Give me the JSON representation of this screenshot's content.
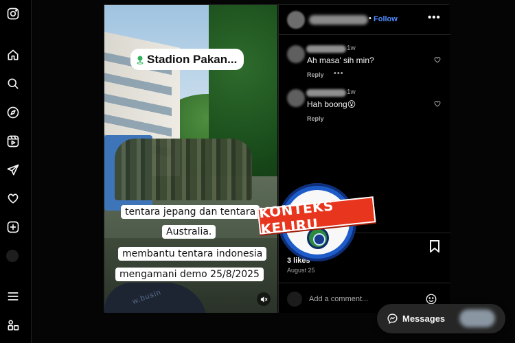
{
  "post": {
    "location": "Stadion Pakan...",
    "captions": [
      "tentara jepang dan tentara",
      "Australia.",
      "membantu tentara indonesia",
      "mengamani demo 25/8/2025"
    ],
    "shirt_text": "w.busin"
  },
  "header": {
    "dot": "•",
    "follow_label": "Follow",
    "more_label": "•••"
  },
  "comments": [
    {
      "age": "1w",
      "text": "Ah masa' sih min?",
      "reply": "Reply",
      "more": "•••"
    },
    {
      "age": "1w",
      "text": "Hah boong😮",
      "reply": "Reply"
    }
  ],
  "likes": "3 likes",
  "date": "August 25",
  "add_comment": {
    "placeholder": "Add a comment..."
  },
  "stamp": {
    "label": "KONTEKS KELIRU"
  },
  "messages": {
    "label": "Messages"
  },
  "colors": {
    "accent_blue": "#4e8dff",
    "stamp_red": "#e8361e",
    "stamp_blue": "#1d5cc8"
  }
}
